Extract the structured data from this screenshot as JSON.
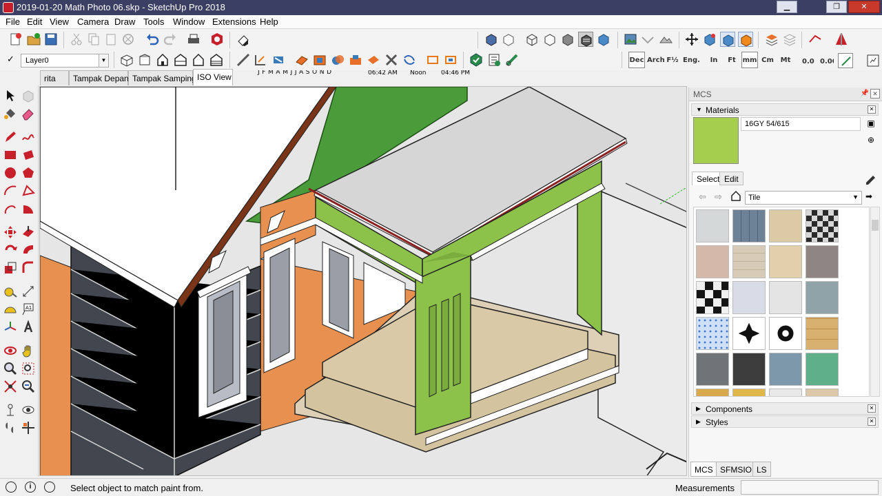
{
  "window": {
    "title": "2019-01-20 Math Photo 06.skp - SketchUp Pro 2018",
    "minimize": "▁",
    "maximize": "❐",
    "close": "✕"
  },
  "menu": [
    "File",
    "Edit",
    "View",
    "Camera",
    "Draw",
    "Tools",
    "Window",
    "Extensions",
    "Help"
  ],
  "shadow_bar": {
    "months": [
      "J",
      "F",
      "M",
      "A",
      "M",
      "J",
      "J",
      "A",
      "S",
      "O",
      "N",
      "D"
    ],
    "time_start": "06:42 AM",
    "time_mid": "Noon",
    "time_end": "04:46 PM"
  },
  "units": [
    "Dec",
    "Arch",
    "F½",
    "Eng.",
    "In",
    "Ft",
    "mm",
    "Cm",
    "Mt",
    "Fdiv",
    "Fprec"
  ],
  "layer": {
    "current": "Layer0"
  },
  "scene_tabs": [
    {
      "label": "rita",
      "active": false
    },
    {
      "label": "Tampak Depan",
      "active": false
    },
    {
      "label": "Tampak Samping",
      "active": false
    },
    {
      "label": "ISO View",
      "active": true
    }
  ],
  "tray": {
    "title": "MCS",
    "materials_header": "Materials",
    "material_name": "16GY 54/615",
    "material_color": "#a5cd4e",
    "tab_select": "Select",
    "tab_edit": "Edit",
    "collection": "Tile",
    "components_header": "Components",
    "styles_header": "Styles"
  },
  "bottom_tabs": [
    "MCS",
    "SFMSIO",
    "LS"
  ],
  "status": {
    "message": "Select object to match paint from.",
    "measurements_label": "Measurements",
    "measurements_value": ""
  }
}
